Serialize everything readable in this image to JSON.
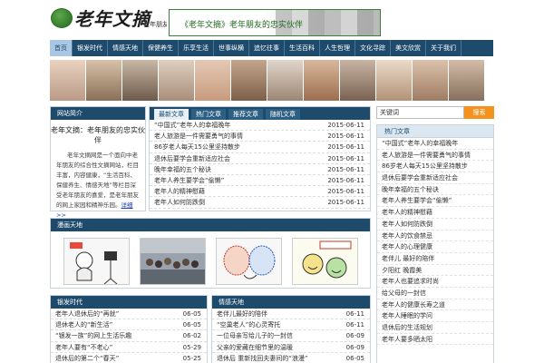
{
  "header": {
    "logo_text": "老年文摘",
    "slogan": "老年朋友的忠实伙伴",
    "banner_text": "《老年文摘》老年朋友的忠实伙伴"
  },
  "nav": [
    {
      "label": "首页",
      "active": true
    },
    {
      "label": "银发时代"
    },
    {
      "label": "情感天地"
    },
    {
      "label": "保健养生"
    },
    {
      "label": "乐享生活"
    },
    {
      "label": "世事纵横"
    },
    {
      "label": "追忆往事"
    },
    {
      "label": "生活百科"
    },
    {
      "label": "人生哲理"
    },
    {
      "label": "文化寻踪"
    },
    {
      "label": "美文欣赏"
    },
    {
      "label": "关于我们"
    }
  ],
  "intro": {
    "head": "网站简介",
    "title": "老年文摘：老年朋友的忠实伙伴",
    "text": "老年文摘网是一个面向中老年朋友的综合性文摘网站，栏目丰富，内容健康，“生活百科、保健养生、情感天地”等栏目深受老年朋友的喜爱，是老年朋友的网上家园和精神乐园。",
    "more": "详细>>"
  },
  "news": {
    "tabs": [
      "最新文章",
      "热门文章",
      "推荐文章",
      "随机文章"
    ],
    "items": [
      {
        "title": "“中国式”老年人的幸福晚年",
        "date": "2015-06-11"
      },
      {
        "title": "老人旅游是一件需要勇气的事情",
        "date": "2015-06-11"
      },
      {
        "title": "86岁老人每天15公里坚持散步",
        "date": "2015-06-11"
      },
      {
        "title": "退休后要学会重新适应社会",
        "date": "2015-06-11"
      },
      {
        "title": "晚年幸福的五个秘诀",
        "date": "2015-06-11"
      },
      {
        "title": "老年人养生要学会“偷懒”",
        "date": "2015-06-11"
      },
      {
        "title": "老年人的精神慰藉",
        "date": "2015-06-11"
      },
      {
        "title": "老年人如何防跌倒",
        "date": "2015-06-11"
      }
    ]
  },
  "search": {
    "placeholder": "关键词",
    "button": "搜索"
  },
  "sidebar": {
    "head": "热门文章",
    "items": [
      "“中国式”老年人的幸福晚年",
      "老人旅游是一件需要勇气的事情",
      "86岁老人每天15公里坚持散步",
      "退休后要学会重新适应社会",
      "晚年幸福的五个秘诀",
      "老年人养生要学会“偷懒”",
      "老年人的精神慰藉",
      "老年人如何防跌倒",
      "老年人的饮食禁忌",
      "老年人的心理健康",
      "老伴儿 最好的陪伴",
      "夕阳红 晚霞美",
      "老年人也要追求时尚",
      "给父母的一封信",
      "老年人的健康长寿之道",
      "老年人睡眠的学问",
      "退休后的生活规划",
      "老年人要多晒太阳"
    ]
  },
  "comics": {
    "head": "漫画天地"
  },
  "bottom_left": {
    "head": "银发时代",
    "items": [
      {
        "title": "老年人退休后的“再就”",
        "date": "06-05"
      },
      {
        "title": "退休老人的“新生活”",
        "date": "06-05"
      },
      {
        "title": "“银发一族”的网上生活乐趣",
        "date": "06-02"
      },
      {
        "title": "老年人要有“不老心”",
        "date": "05-29"
      },
      {
        "title": "退休后的第二个“春天”",
        "date": "05-25"
      }
    ]
  },
  "bottom_right": {
    "head": "情感天地",
    "items": [
      {
        "title": "老伴儿最好的陪伴",
        "date": "06-11"
      },
      {
        "title": "“空巢老人”的心灵寄托",
        "date": "06-11"
      },
      {
        "title": "一位母亲写给儿子的一封信",
        "date": "06-09"
      },
      {
        "title": "父亲的爱藏在细节里的温暖",
        "date": "06-09"
      },
      {
        "title": "退休后 重新找回夫妻间的“浪漫”",
        "date": "06-05"
      }
    ]
  },
  "colors": {
    "nav_bg": "#1e4a6b",
    "search_button": "#f4921e",
    "active_tab": "#a9c7e2"
  }
}
